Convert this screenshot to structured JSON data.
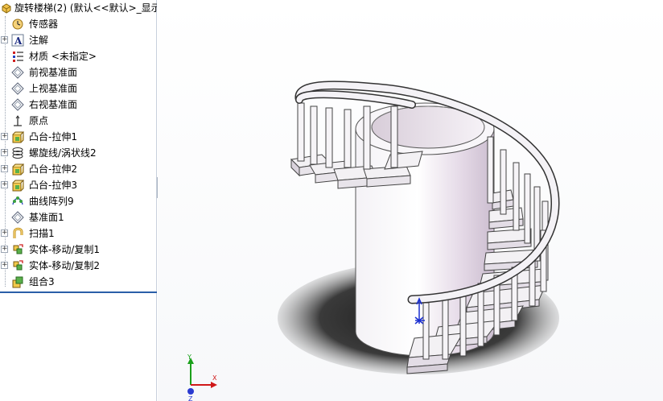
{
  "tree": {
    "title": "旋转楼梯(2)  (默认<<默认>_显示",
    "items": [
      {
        "label": "传感器",
        "icon": "sensor-icon",
        "expandable": false
      },
      {
        "label": "注解",
        "icon": "annotation-icon",
        "expandable": true
      },
      {
        "label": "材质 <未指定>",
        "icon": "material-icon",
        "expandable": false
      },
      {
        "label": "前视基准面",
        "icon": "plane-icon",
        "expandable": false
      },
      {
        "label": "上视基准面",
        "icon": "plane-icon",
        "expandable": false
      },
      {
        "label": "右视基准面",
        "icon": "plane-icon",
        "expandable": false
      },
      {
        "label": "原点",
        "icon": "origin-icon",
        "expandable": false
      },
      {
        "label": "凸台-拉伸1",
        "icon": "boss-extrude-icon",
        "expandable": true
      },
      {
        "label": "螺旋线/涡状线2",
        "icon": "helix-icon",
        "expandable": true
      },
      {
        "label": "凸台-拉伸2",
        "icon": "boss-extrude-icon",
        "expandable": true
      },
      {
        "label": "凸台-拉伸3",
        "icon": "boss-extrude-icon",
        "expandable": true
      },
      {
        "label": "曲线阵列9",
        "icon": "curve-pattern-icon",
        "expandable": false
      },
      {
        "label": "基准面1",
        "icon": "plane-icon",
        "expandable": false
      },
      {
        "label": "扫描1",
        "icon": "sweep-icon",
        "expandable": true
      },
      {
        "label": "实体-移动/复制1",
        "icon": "move-copy-icon",
        "expandable": true
      },
      {
        "label": "实体-移动/复制2",
        "icon": "move-copy-icon",
        "expandable": true
      },
      {
        "label": "组合3",
        "icon": "combine-icon",
        "expandable": false
      }
    ]
  },
  "triad": {
    "y": "Y",
    "x": "X",
    "z": "Z"
  },
  "colors": {
    "accent": "#2a5ea8",
    "model": "#f2eef4",
    "shadow": "#303030"
  }
}
